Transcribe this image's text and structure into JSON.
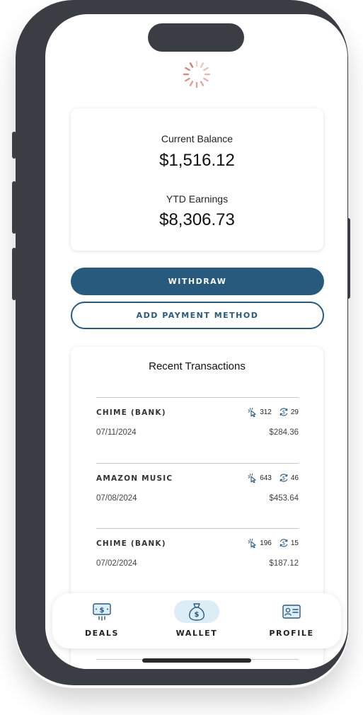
{
  "balance": {
    "current_label": "Current Balance",
    "current_value": "$1,516.12",
    "ytd_label": "YTD Earnings",
    "ytd_value": "$8,306.73"
  },
  "actions": {
    "withdraw_label": "WITHDRAW",
    "add_payment_label": "ADD PAYMENT METHOD"
  },
  "transactions": {
    "title": "Recent Transactions",
    "items": [
      {
        "name": "CHIME (BANK)",
        "date": "07/11/2024",
        "amount": "$284.36",
        "clicks": "312",
        "conversions": "29"
      },
      {
        "name": "AMAZON MUSIC",
        "date": "07/08/2024",
        "amount": "$453.64",
        "clicks": "643",
        "conversions": "46"
      },
      {
        "name": "CHIME (BANK)",
        "date": "07/02/2024",
        "amount": "$187.12",
        "clicks": "196",
        "conversions": "15"
      }
    ]
  },
  "nav": {
    "items": [
      {
        "label": "DEALS",
        "icon": "cash-icon"
      },
      {
        "label": "WALLET",
        "icon": "money-bag-icon",
        "active": true
      },
      {
        "label": "PROFILE",
        "icon": "id-card-icon"
      }
    ]
  },
  "colors": {
    "primary": "#285a7e",
    "spinner": "#d27c72",
    "active_nav_bg": "#dcedf5",
    "frame": "#3a3e44"
  },
  "icons": {
    "clicks": "cursor-click-icon",
    "conversions": "dollar-cycle-icon"
  }
}
